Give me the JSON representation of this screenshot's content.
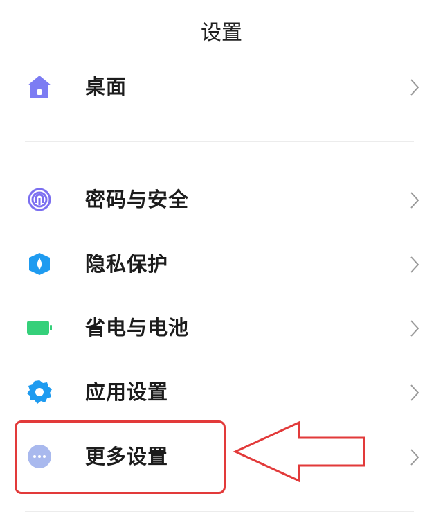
{
  "header": {
    "title": "设置"
  },
  "settings_items": [
    {
      "label": "桌面",
      "icon": "home-icon",
      "color": "#7c7cf3"
    },
    {
      "label": "密码与安全",
      "icon": "fingerprint-icon",
      "color": "#7b6ff0"
    },
    {
      "label": "隐私保护",
      "icon": "privacy-shield-icon",
      "color": "#1e9bf0"
    },
    {
      "label": "省电与电池",
      "icon": "battery-icon",
      "color": "#35d07a"
    },
    {
      "label": "应用设置",
      "icon": "gear-icon",
      "color": "#1e9bf0"
    },
    {
      "label": "更多设置",
      "icon": "more-dots-icon",
      "color": "#a9b9ee"
    }
  ],
  "annotation": {
    "highlight_color": "#e23a3a",
    "target": "更多设置"
  }
}
